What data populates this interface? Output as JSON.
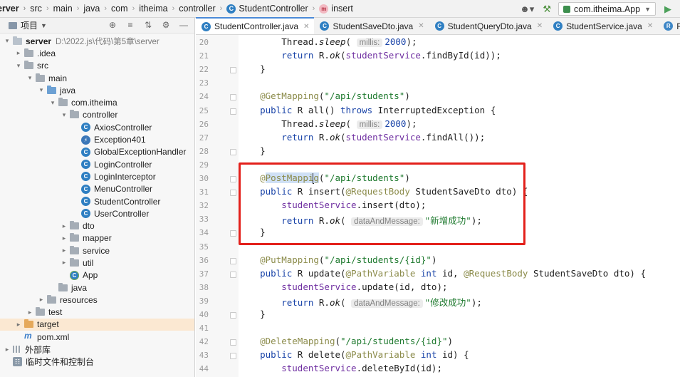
{
  "breadcrumb": [
    "erver",
    "src",
    "main",
    "java",
    "com",
    "itheima",
    "controller",
    "StudentController",
    "insert"
  ],
  "toolbar": {
    "user_icon": "person-dropdown-icon",
    "hammer_icon": "build-hammer-icon",
    "run_config": "com.itheima.App",
    "run_icon": "run-triangle-icon"
  },
  "project": {
    "title": "项目",
    "tree": [
      {
        "level": 0,
        "arrow": "down",
        "icon": "folder-plain",
        "label": "server",
        "extra": "D:\\2022.js\\代码\\第5章\\server",
        "bold": true
      },
      {
        "level": 1,
        "arrow": "right",
        "icon": "folder-gray",
        "label": ".idea"
      },
      {
        "level": 1,
        "arrow": "down",
        "icon": "folder-gray",
        "label": "src"
      },
      {
        "level": 2,
        "arrow": "down",
        "icon": "folder-gray",
        "label": "main"
      },
      {
        "level": 3,
        "arrow": "down",
        "icon": "folder-blue",
        "label": "java"
      },
      {
        "level": 4,
        "arrow": "down",
        "icon": "folder-gray",
        "label": "com.itheima"
      },
      {
        "level": 5,
        "arrow": "down",
        "icon": "folder-gray",
        "label": "controller"
      },
      {
        "level": 6,
        "arrow": "",
        "icon": "class",
        "label": "AxiosController"
      },
      {
        "level": 6,
        "arrow": "",
        "icon": "exception",
        "label": "Exception401"
      },
      {
        "level": 6,
        "arrow": "",
        "icon": "class",
        "label": "GlobalExceptionHandler"
      },
      {
        "level": 6,
        "arrow": "",
        "icon": "class",
        "label": "LoginController"
      },
      {
        "level": 6,
        "arrow": "",
        "icon": "class",
        "label": "LoginInterceptor"
      },
      {
        "level": 6,
        "arrow": "",
        "icon": "class",
        "label": "MenuController"
      },
      {
        "level": 6,
        "arrow": "",
        "icon": "class",
        "label": "StudentController"
      },
      {
        "level": 6,
        "arrow": "",
        "icon": "class",
        "label": "UserController"
      },
      {
        "level": 5,
        "arrow": "right",
        "icon": "folder-gray",
        "label": "dto"
      },
      {
        "level": 5,
        "arrow": "right",
        "icon": "folder-gray",
        "label": "mapper"
      },
      {
        "level": 5,
        "arrow": "right",
        "icon": "folder-gray",
        "label": "service"
      },
      {
        "level": 5,
        "arrow": "right",
        "icon": "folder-gray",
        "label": "util"
      },
      {
        "level": 5,
        "arrow": "",
        "icon": "app",
        "label": "App"
      },
      {
        "level": 4,
        "arrow": "",
        "icon": "folder-gray",
        "label": "java"
      },
      {
        "level": 3,
        "arrow": "right",
        "icon": "folder-gray",
        "label": "resources"
      },
      {
        "level": 2,
        "arrow": "right",
        "icon": "folder-gray",
        "label": "test"
      },
      {
        "level": 1,
        "arrow": "right",
        "icon": "folder-orange",
        "label": "target",
        "highlight": true
      },
      {
        "level": 1,
        "arrow": "",
        "icon": "maven",
        "label": "pom.xml"
      },
      {
        "level": 0,
        "arrow": "right",
        "icon": "bars",
        "label": "外部库"
      },
      {
        "level": 0,
        "arrow": "",
        "icon": "scratch",
        "label": "临时文件和控制台"
      }
    ]
  },
  "tabs": [
    {
      "label": "StudentController.java",
      "active": true
    },
    {
      "label": "StudentSaveDto.java",
      "active": false
    },
    {
      "label": "StudentQueryDto.java",
      "active": false
    },
    {
      "label": "StudentService.java",
      "active": false
    },
    {
      "label": "R.java",
      "active": false
    }
  ],
  "editor": {
    "line_numbers": [
      20,
      21,
      22,
      23,
      24,
      25,
      26,
      27,
      28,
      29,
      30,
      31,
      32,
      33,
      34,
      35,
      36,
      37,
      38,
      39,
      40,
      41,
      42,
      43,
      44
    ],
    "lines": [
      [
        {
          "t": "        Thread."
        },
        {
          "t": "sleep",
          "c": "it"
        },
        {
          "t": "( "
        },
        {
          "t": "millis:",
          "c": "hint"
        },
        {
          "t": "2000",
          "c": "kw"
        },
        {
          "t": ");"
        }
      ],
      [
        {
          "t": "        "
        },
        {
          "t": "return",
          "c": "kw"
        },
        {
          "t": " R."
        },
        {
          "t": "ok",
          "c": "it"
        },
        {
          "t": "("
        },
        {
          "t": "studentService",
          "c": "fn"
        },
        {
          "t": ".findById(id));"
        }
      ],
      [
        {
          "t": "    }"
        }
      ],
      [
        {
          "t": ""
        }
      ],
      [
        {
          "t": "    "
        },
        {
          "t": "@GetMapping",
          "c": "an"
        },
        {
          "t": "("
        },
        {
          "t": "\"/api/students\"",
          "c": "st"
        },
        {
          "t": ")"
        }
      ],
      [
        {
          "t": "    "
        },
        {
          "t": "public",
          "c": "kw"
        },
        {
          "t": " R all() "
        },
        {
          "t": "throws",
          "c": "kw"
        },
        {
          "t": " InterruptedException {"
        }
      ],
      [
        {
          "t": "        Thread."
        },
        {
          "t": "sleep",
          "c": "it"
        },
        {
          "t": "( "
        },
        {
          "t": "millis:",
          "c": "hint"
        },
        {
          "t": "2000",
          "c": "kw"
        },
        {
          "t": ");"
        }
      ],
      [
        {
          "t": "        "
        },
        {
          "t": "return",
          "c": "kw"
        },
        {
          "t": " R."
        },
        {
          "t": "ok",
          "c": "it"
        },
        {
          "t": "("
        },
        {
          "t": "studentService",
          "c": "fn"
        },
        {
          "t": ".findAll());"
        }
      ],
      [
        {
          "t": "    }"
        }
      ],
      [
        {
          "t": ""
        }
      ],
      [
        {
          "t": "    "
        },
        {
          "t": "@",
          "c": "an"
        },
        {
          "t": "PostMappi",
          "c": "an sel"
        },
        {
          "t": "|",
          "c": "caret"
        },
        {
          "t": "g",
          "c": "an sel"
        },
        {
          "t": "("
        },
        {
          "t": "\"/api/students\"",
          "c": "st"
        },
        {
          "t": ")"
        }
      ],
      [
        {
          "t": "    "
        },
        {
          "t": "public",
          "c": "kw"
        },
        {
          "t": " R insert("
        },
        {
          "t": "@RequestBody",
          "c": "an"
        },
        {
          "t": " StudentSaveDto dto) {"
        }
      ],
      [
        {
          "t": "        "
        },
        {
          "t": "studentService",
          "c": "fn"
        },
        {
          "t": ".insert(dto);"
        }
      ],
      [
        {
          "t": "        "
        },
        {
          "t": "return",
          "c": "kw"
        },
        {
          "t": " R."
        },
        {
          "t": "ok",
          "c": "it"
        },
        {
          "t": "( "
        },
        {
          "t": "dataAndMessage:",
          "c": "hint"
        },
        {
          "t": "\"新增成功\"",
          "c": "st"
        },
        {
          "t": ");"
        }
      ],
      [
        {
          "t": "    }"
        }
      ],
      [
        {
          "t": ""
        }
      ],
      [
        {
          "t": "    "
        },
        {
          "t": "@PutMapping",
          "c": "an"
        },
        {
          "t": "("
        },
        {
          "t": "\"/api/students/{id}\"",
          "c": "st"
        },
        {
          "t": ")"
        }
      ],
      [
        {
          "t": "    "
        },
        {
          "t": "public",
          "c": "kw"
        },
        {
          "t": " R update("
        },
        {
          "t": "@PathVariable",
          "c": "an"
        },
        {
          "t": " "
        },
        {
          "t": "int",
          "c": "kw"
        },
        {
          "t": " id, "
        },
        {
          "t": "@RequestBody",
          "c": "an"
        },
        {
          "t": " StudentSaveDto dto) {"
        }
      ],
      [
        {
          "t": "        "
        },
        {
          "t": "studentService",
          "c": "fn"
        },
        {
          "t": ".update(id, dto);"
        }
      ],
      [
        {
          "t": "        "
        },
        {
          "t": "return",
          "c": "kw"
        },
        {
          "t": " R."
        },
        {
          "t": "ok",
          "c": "it"
        },
        {
          "t": "( "
        },
        {
          "t": "dataAndMessage:",
          "c": "hint"
        },
        {
          "t": "\"修改成功\"",
          "c": "st"
        },
        {
          "t": ");"
        }
      ],
      [
        {
          "t": "    }"
        }
      ],
      [
        {
          "t": ""
        }
      ],
      [
        {
          "t": "    "
        },
        {
          "t": "@DeleteMapping",
          "c": "an"
        },
        {
          "t": "("
        },
        {
          "t": "\"/api/students/{id}\"",
          "c": "st"
        },
        {
          "t": ")"
        }
      ],
      [
        {
          "t": "    "
        },
        {
          "t": "public",
          "c": "kw"
        },
        {
          "t": " R delete("
        },
        {
          "t": "@PathVariable",
          "c": "an"
        },
        {
          "t": " "
        },
        {
          "t": "int",
          "c": "kw"
        },
        {
          "t": " id) {"
        }
      ],
      [
        {
          "t": "        "
        },
        {
          "t": "studentService",
          "c": "fn"
        },
        {
          "t": ".deleteById(id);"
        }
      ]
    ]
  },
  "colors": {
    "annotation_box": "#e3201b",
    "keyword": "#1a44a8",
    "string": "#1f7a2f",
    "field": "#6f2fa1",
    "annotation": "#8b8b4a"
  }
}
